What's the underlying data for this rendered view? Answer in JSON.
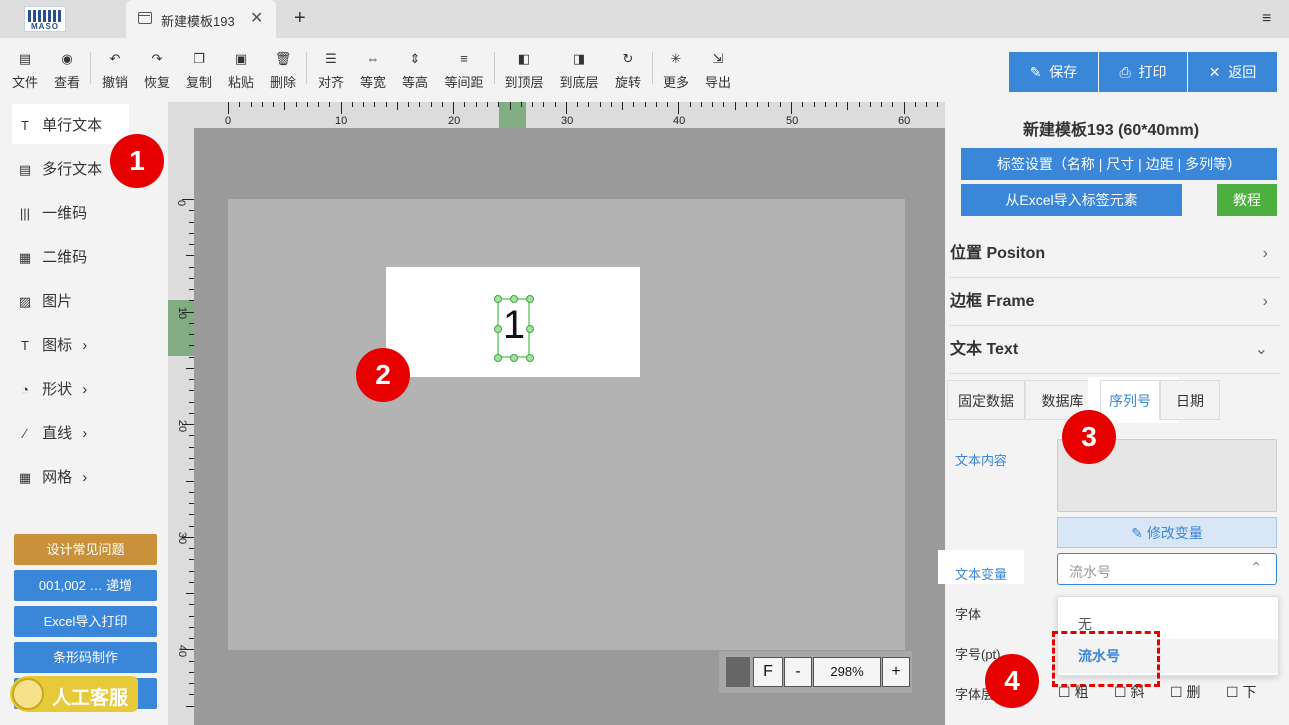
{
  "app": {
    "logo_text": "MASO"
  },
  "tab": {
    "title": "新建模板193",
    "close": "✕",
    "new": "+"
  },
  "menu_icon": "≡",
  "toolbar": [
    {
      "id": "file",
      "icon": "▤",
      "label": "文件"
    },
    {
      "id": "view",
      "icon": "◉",
      "label": "查看"
    },
    {
      "id": "undo",
      "icon": "↶",
      "label": "撤销"
    },
    {
      "id": "redo",
      "icon": "↷",
      "label": "恢复"
    },
    {
      "id": "copy",
      "icon": "❐",
      "label": "复制"
    },
    {
      "id": "paste",
      "icon": "▣",
      "label": "粘贴"
    },
    {
      "id": "delete",
      "icon": "🗑",
      "label": "删除"
    },
    {
      "id": "align",
      "icon": "☰",
      "label": "对齐"
    },
    {
      "id": "samewidth",
      "icon": "⇔",
      "label": "等宽"
    },
    {
      "id": "sameheight",
      "icon": "⇕",
      "label": "等高"
    },
    {
      "id": "samespacing",
      "icon": "≡",
      "label": "等间距"
    },
    {
      "id": "totop",
      "icon": "◧",
      "label": "到顶层"
    },
    {
      "id": "tobottom",
      "icon": "◨",
      "label": "到底层"
    },
    {
      "id": "rotate",
      "icon": "↻",
      "label": "旋转"
    },
    {
      "id": "more",
      "icon": "✳",
      "label": "更多"
    },
    {
      "id": "export",
      "icon": "⇲",
      "label": "导出"
    }
  ],
  "actions": {
    "save": "保存",
    "print": "打印",
    "back": "返回",
    "save_icon": "✎",
    "print_icon": "⎙",
    "back_icon": "✕"
  },
  "sidebar": {
    "items": [
      {
        "icon": "T",
        "label": "单行文本",
        "arrow": ""
      },
      {
        "icon": "▤",
        "label": "多行文本",
        "arrow": ""
      },
      {
        "icon": "|||",
        "label": "一维码",
        "arrow": ""
      },
      {
        "icon": "▦",
        "label": "二维码",
        "arrow": ""
      },
      {
        "icon": "▨",
        "label": "图片",
        "arrow": ""
      },
      {
        "icon": "T",
        "label": "图标",
        "arrow": "›"
      },
      {
        "icon": "◔",
        "label": "形状",
        "arrow": "›"
      },
      {
        "icon": "∕",
        "label": "直线",
        "arrow": "›"
      },
      {
        "icon": "▦",
        "label": "网格",
        "arrow": "›"
      }
    ],
    "buttons": [
      {
        "label": "设计常见问题",
        "color": "#c9923a"
      },
      {
        "label": "001,002 … 递增",
        "color": "#3a86d9"
      },
      {
        "label": "Excel导入打印",
        "color": "#3a86d9"
      },
      {
        "label": "条形码制作",
        "color": "#3a86d9"
      },
      {
        "label": "",
        "color": "#3a86d9"
      }
    ],
    "support": "人工客服"
  },
  "ruler": {
    "h_labels": [
      "0",
      "10",
      "20",
      "30",
      "40",
      "50",
      "60"
    ],
    "v_labels": [
      "0",
      "10",
      "20",
      "30",
      "40"
    ]
  },
  "canvas": {
    "element_text": "1"
  },
  "zoom": {
    "mode": "F",
    "minus": "-",
    "value": "298%",
    "plus": "+"
  },
  "panel": {
    "title": "新建模板193 (60*40mm)",
    "label_settings": "标签设置（名称 | 尺寸 | 边距 | 多列等）",
    "import_excel": "从Excel导入标签元素",
    "tutorial": "教程",
    "sections": [
      {
        "label": "位置 Positon",
        "chevron": "›"
      },
      {
        "label": "边框 Frame",
        "chevron": "›"
      },
      {
        "label": "文本 Text",
        "chevron": "⌄"
      }
    ],
    "text_tabs": [
      "固定数据",
      "数据库",
      "序列号",
      "日期"
    ],
    "active_tab_index": 2,
    "content_label": "文本内容",
    "modify_variable": "修改变量",
    "variable_label": "文本变量",
    "variable_value": "流水号",
    "variable_options": [
      "无",
      "流水号"
    ],
    "font_label": "字体",
    "size_label": "字号(pt)",
    "style_label": "字体层",
    "styles": [
      "粗",
      "斜",
      "删",
      "下"
    ]
  },
  "badges": [
    "1",
    "2",
    "3",
    "4"
  ],
  "colors": {
    "accent": "#3a86d9",
    "badge": "#e60000",
    "selection": "#8fdc8f",
    "tutorial": "#4caf3f",
    "faq": "#c9923a"
  }
}
